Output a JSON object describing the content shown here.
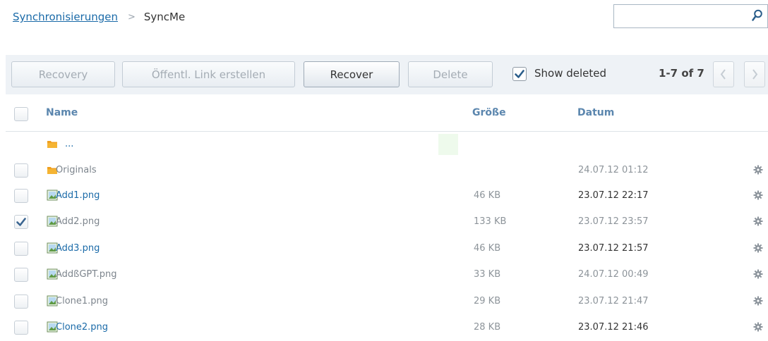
{
  "breadcrumb": {
    "parent": "Synchronisierungen",
    "separator": ">",
    "current": "SyncMe"
  },
  "search": {
    "value": "",
    "placeholder": ""
  },
  "toolbar": {
    "recovery": "Recovery",
    "public_link": "Öffentl. Link erstellen",
    "recover": "Recover",
    "delete": "Delete",
    "show_deleted": "Show deleted",
    "show_deleted_checked": true,
    "pager": "1-7 of 7"
  },
  "table": {
    "columns": {
      "name": "Name",
      "size": "Größe",
      "date": "Datum"
    },
    "up_row": {
      "label": "..."
    },
    "rows": [
      {
        "name": "Originals",
        "type": "folder",
        "size": "",
        "date": "24.07.12 01:12",
        "checked": false,
        "style": "deleted"
      },
      {
        "name": "Add1.png",
        "type": "image",
        "size": "46 KB",
        "date": "23.07.12 22:17",
        "checked": false,
        "style": "normal"
      },
      {
        "name": "Add2.png",
        "type": "image",
        "size": "133 KB",
        "date": "23.07.12 23:57",
        "checked": true,
        "style": "deleted"
      },
      {
        "name": "Add3.png",
        "type": "image",
        "size": "46 KB",
        "date": "23.07.12 21:57",
        "checked": false,
        "style": "normal"
      },
      {
        "name": "AddßGPT.png",
        "type": "image",
        "size": "33 KB",
        "date": "24.07.12 00:49",
        "checked": false,
        "style": "deleted"
      },
      {
        "name": "Clone1.png",
        "type": "image",
        "size": "29 KB",
        "date": "23.07.12 21:47",
        "checked": false,
        "style": "deleted"
      },
      {
        "name": "Clone2.png",
        "type": "image",
        "size": "28 KB",
        "date": "23.07.12 21:46",
        "checked": false,
        "style": "normal"
      }
    ]
  },
  "colors": {
    "link": "#1a6aa8",
    "header": "#5b86ae",
    "folder": "#f0a020",
    "toolbar_bg": "#eef2f6"
  }
}
